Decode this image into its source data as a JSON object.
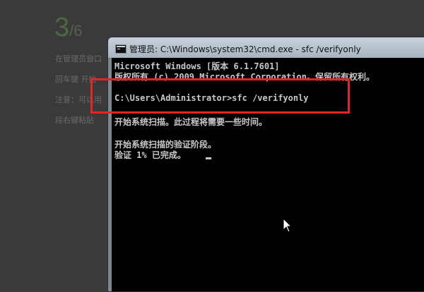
{
  "background": {
    "step_number": "3",
    "step_total": "/6",
    "lines": [
      "在管理员窗口",
      "回车键 开始",
      "注意：可以用",
      "段右键粘贴"
    ]
  },
  "window": {
    "title": "管理员: C:\\Windows\\system32\\cmd.exe - sfc  /verifyonly",
    "console_lines": [
      "Microsoft Windows [版本 6.1.7601]",
      "版权所有 (c) 2009 Microsoft Corporation。保留所有权利。",
      "C:\\Users\\Administrator>sfc /verifyonly",
      "开始系统扫描。此过程将需要一些时间。",
      "开始系统扫描的验证阶段。",
      "验证 1% 已完成。"
    ]
  },
  "icons": {
    "app": "cmd-icon",
    "pointer": "mouse-pointer-icon"
  },
  "colors": {
    "highlight": "#e32525",
    "console_bg": "#000000",
    "console_text": "#c8c8c8"
  }
}
